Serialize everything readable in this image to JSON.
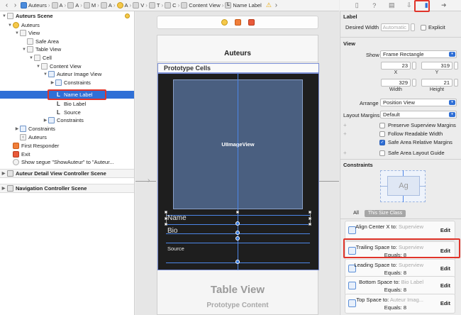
{
  "jumpbar": {
    "crumbs": [
      "Auteurs",
      "A",
      "A",
      "M",
      "A",
      "A",
      "V",
      "T",
      "C",
      "Content View",
      "Name Label"
    ]
  },
  "outline": {
    "rows": [
      {
        "label": "Auteurs Scene"
      },
      {
        "label": "Auteurs"
      },
      {
        "label": "View"
      },
      {
        "label": "Safe Area"
      },
      {
        "label": "Table View"
      },
      {
        "label": "Cell"
      },
      {
        "label": "Content View"
      },
      {
        "label": "Auteur Image View"
      },
      {
        "label": "Constraints"
      },
      {
        "label": "Name Label"
      },
      {
        "label": "Bio Label"
      },
      {
        "label": "Source"
      },
      {
        "label": "Constraints"
      },
      {
        "label": "Constraints"
      },
      {
        "label": "Auteurs"
      },
      {
        "label": "First Responder"
      },
      {
        "label": "Exit"
      },
      {
        "label": "Show segue \"ShowAuteur\" to \"Auteur..."
      }
    ],
    "scenes": [
      "Auteur Detail View Controller Scene",
      "Navigation Controller Scene"
    ]
  },
  "canvas": {
    "nav_title": "Auteurs",
    "prototype_header": "Prototype Cells",
    "image_view_label": "UIImageView",
    "name_label": "Name",
    "bio_label": "Bio",
    "source_label": "Source",
    "table_view_title": "Table View",
    "table_view_subtitle": "Prototype Content"
  },
  "inspector": {
    "label_section": "Label",
    "desired_width_label": "Desired Width",
    "desired_width_placeholder": "Automatic",
    "explicit_label": "Explicit",
    "view_section": "View",
    "show_label": "Show",
    "show_value": "Frame Rectangle",
    "x_value": "23",
    "y_value": "319",
    "x_caption": "X",
    "y_caption": "Y",
    "width_value": "329",
    "height_value": "21",
    "width_caption": "Width",
    "height_caption": "Height",
    "arrange_label": "Arrange",
    "arrange_value": "Position View",
    "layout_margins_label": "Layout Margins",
    "layout_margins_value": "Default",
    "preserve_label": "Preserve Superview Margins",
    "follow_label": "Follow Readable Width",
    "safe_area_relative_label": "Safe Area Relative Margins",
    "safe_area_guide_label": "Safe Area Layout Guide",
    "constraints_section": "Constraints",
    "diagram_text": "Ag",
    "seg_all": "All",
    "seg_this": "This Size Class",
    "constraints": [
      {
        "title": "Align Center X to:",
        "target": "Superview",
        "equals": "",
        "edit": "Edit"
      },
      {
        "title": "Trailing Space to:",
        "target": "Superview",
        "equals": "Equals:  8",
        "edit": "Edit"
      },
      {
        "title": "Leading Space to:",
        "target": "Superview",
        "equals": "Equals:  8",
        "edit": "Edit"
      },
      {
        "title": "Bottom Space to:",
        "target": "Bio Label",
        "equals": "Equals:  8",
        "edit": "Edit"
      },
      {
        "title": "Top Space to:",
        "target": "Auteur Imag...",
        "equals": "Equals:  8",
        "edit": "Edit"
      }
    ]
  },
  "colors": {
    "selection": "#2f6fd6",
    "highlight_box": "#e0342a",
    "constraint_line": "#4d86e8"
  }
}
